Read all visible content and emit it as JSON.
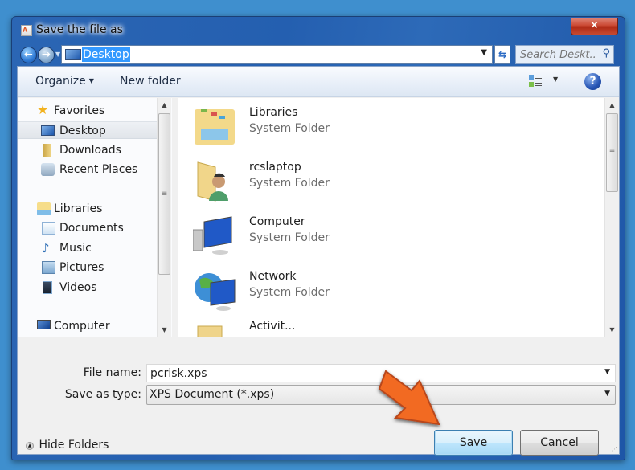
{
  "window": {
    "title": "Save the file as",
    "close_label": "×"
  },
  "navigation": {
    "back_glyph": "←",
    "forward_glyph": "→",
    "address": "Desktop",
    "search_placeholder": "Search Deskt...",
    "search_value": ""
  },
  "toolbar": {
    "organize_label": "Organize",
    "new_folder_label": "New folder",
    "help_glyph": "?"
  },
  "sidebar": {
    "items": [
      {
        "label": "Favorites",
        "icon": "star-icon",
        "group": true
      },
      {
        "label": "Desktop",
        "icon": "desktop-icon",
        "selected": true
      },
      {
        "label": "Downloads",
        "icon": "downloads-folder-icon"
      },
      {
        "label": "Recent Places",
        "icon": "recent-places-icon"
      },
      {
        "label": "Libraries",
        "icon": "libraries-icon",
        "group": true
      },
      {
        "label": "Documents",
        "icon": "documents-icon"
      },
      {
        "label": "Music",
        "icon": "music-icon"
      },
      {
        "label": "Pictures",
        "icon": "pictures-icon"
      },
      {
        "label": "Videos",
        "icon": "videos-icon"
      },
      {
        "label": "Computer",
        "icon": "computer-icon",
        "group": true
      }
    ]
  },
  "files": [
    {
      "name": "Libraries",
      "type": "System Folder",
      "icon": "libraries-folder-icon"
    },
    {
      "name": "rcslaptop",
      "type": "System Folder",
      "icon": "user-folder-icon"
    },
    {
      "name": "Computer",
      "type": "System Folder",
      "icon": "computer-icon"
    },
    {
      "name": "Network",
      "type": "System Folder",
      "icon": "network-icon"
    },
    {
      "name": "Activit...",
      "type": "",
      "icon": "folder-icon"
    }
  ],
  "form": {
    "file_name_label": "File name:",
    "file_name_value": "pcrisk.xps",
    "save_type_label": "Save as type:",
    "save_type_value": "XPS Document (*.xps)"
  },
  "footer": {
    "hide_folders_label": "Hide Folders",
    "save_label": "Save",
    "cancel_label": "Cancel"
  },
  "colors": {
    "title_bar": "#245fb0",
    "close_button": "#c64a32",
    "selection": "#3399ff",
    "arrow_annotation": "#f26a21"
  }
}
